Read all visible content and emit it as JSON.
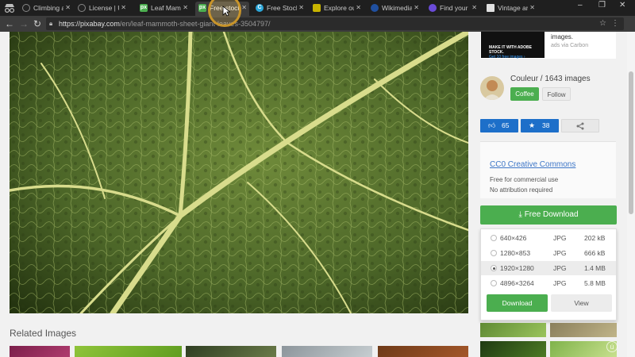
{
  "browser": {
    "tabs": [
      {
        "title": "Climbing a",
        "icon": "camera-icon",
        "color": "#2a2a2a"
      },
      {
        "title": "License | U",
        "icon": "camera-icon",
        "color": "#2a2a2a"
      },
      {
        "title": "Leaf Mamm",
        "icon": "px-icon",
        "color": "#4bae4f",
        "letter": "px"
      },
      {
        "title": "Free stock",
        "icon": "px-icon",
        "color": "#4bae4f",
        "letter": "px",
        "active": true
      },
      {
        "title": "Free Stock",
        "icon": "c-icon",
        "color": "#2ba6d8",
        "letter": "C"
      },
      {
        "title": "Explore ou",
        "icon": "shield-icon",
        "color": "#c8b400"
      },
      {
        "title": "Wikimedia",
        "icon": "wiki-icon",
        "color": "#2050a0"
      },
      {
        "title": "Find your",
        "icon": "flickr-icon",
        "color": "#6a4bd8"
      },
      {
        "title": "Vintage ar",
        "icon": "page-icon",
        "color": "#e0e0e0"
      }
    ],
    "url_host": "https://pixabay.com",
    "url_path": "/en/leaf-mammoth-sheet-giant-leaves-3504797/"
  },
  "ad": {
    "image_line1": "MAKE IT WITH ADOBE STOCK.",
    "image_line2": "Get 10 free images ›",
    "text": "images.",
    "via": "ads via Carbon"
  },
  "user": {
    "name": "Couleur / 1643 images",
    "coffee_label": "Coffee",
    "follow_label": "Follow"
  },
  "votes": {
    "likes": "65",
    "favorites": "38"
  },
  "license": {
    "title": "CC0 Creative Commons",
    "line1": "Free for commercial use",
    "line2": "No attribution required"
  },
  "download": {
    "button_label": "Free Download",
    "options": [
      {
        "resolution": "640×426",
        "format": "JPG",
        "size": "202 kB",
        "selected": false
      },
      {
        "resolution": "1280×853",
        "format": "JPG",
        "size": "666 kB",
        "selected": false
      },
      {
        "resolution": "1920×1280",
        "format": "JPG",
        "size": "1.4 MB",
        "selected": true
      },
      {
        "resolution": "4896×3264",
        "format": "JPG",
        "size": "5.8 MB",
        "selected": false
      }
    ],
    "submit_label": "Download",
    "view_label": "View"
  },
  "related": {
    "title": "Related Images"
  },
  "colors": {
    "accent_green": "#4bae4f",
    "vote_blue": "#1d6fc9",
    "link_blue": "#3d76c7",
    "leaf_green": "#4c6628"
  }
}
